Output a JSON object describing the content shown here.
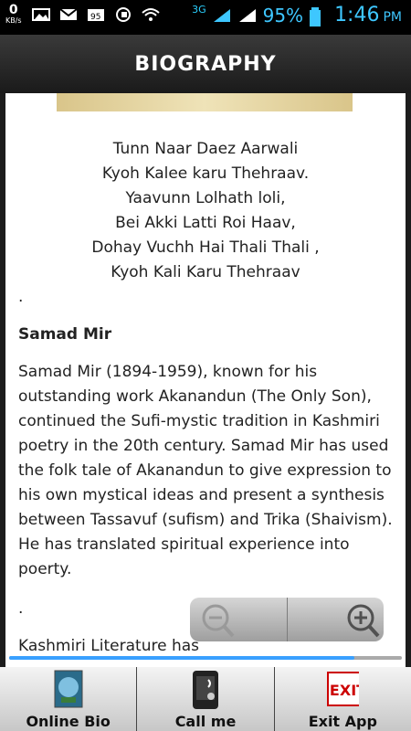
{
  "status": {
    "kbps": "0",
    "kbps_unit": "KB/s",
    "network": "3G",
    "battery_percent": "95%",
    "time": "1:46",
    "ampm": "PM"
  },
  "title": "BIOGRAPHY",
  "content": {
    "verse": [
      "Tunn Naar Daez Aarwali",
      "Kyoh Kalee karu Thehraav.",
      "Yaavunn Lolhath loli,",
      "Bei Akki Latti Roi Haav,",
      "Dohay Vuchh Hai Thali Thali ,",
      "Kyoh Kali Karu Thehraav"
    ],
    "dot1": ".",
    "heading": "Samad Mir",
    "paragraph": "Samad Mir  (1894-1959), known for his outstanding work Akanandun (The Only Son), continued the Sufi-mystic tradition in Kashmiri poetry in the 20th century. Samad Mir has used the folk tale of Akanandun to give expression to his own mystical ideas and present a synthesis between Tassavuf (sufism) and Trika (Shaivism). He has translated spiritual experience into poerty.",
    "dot2": ".",
    "next_line": "Kashmiri Literature has"
  },
  "bottom": {
    "online_bio": "Online Bio",
    "call_me": "Call me",
    "exit_app": "Exit App",
    "exit_badge": "EXIT"
  },
  "colors": {
    "accent": "#3ec7ff",
    "scroll": "#39a0ff"
  }
}
